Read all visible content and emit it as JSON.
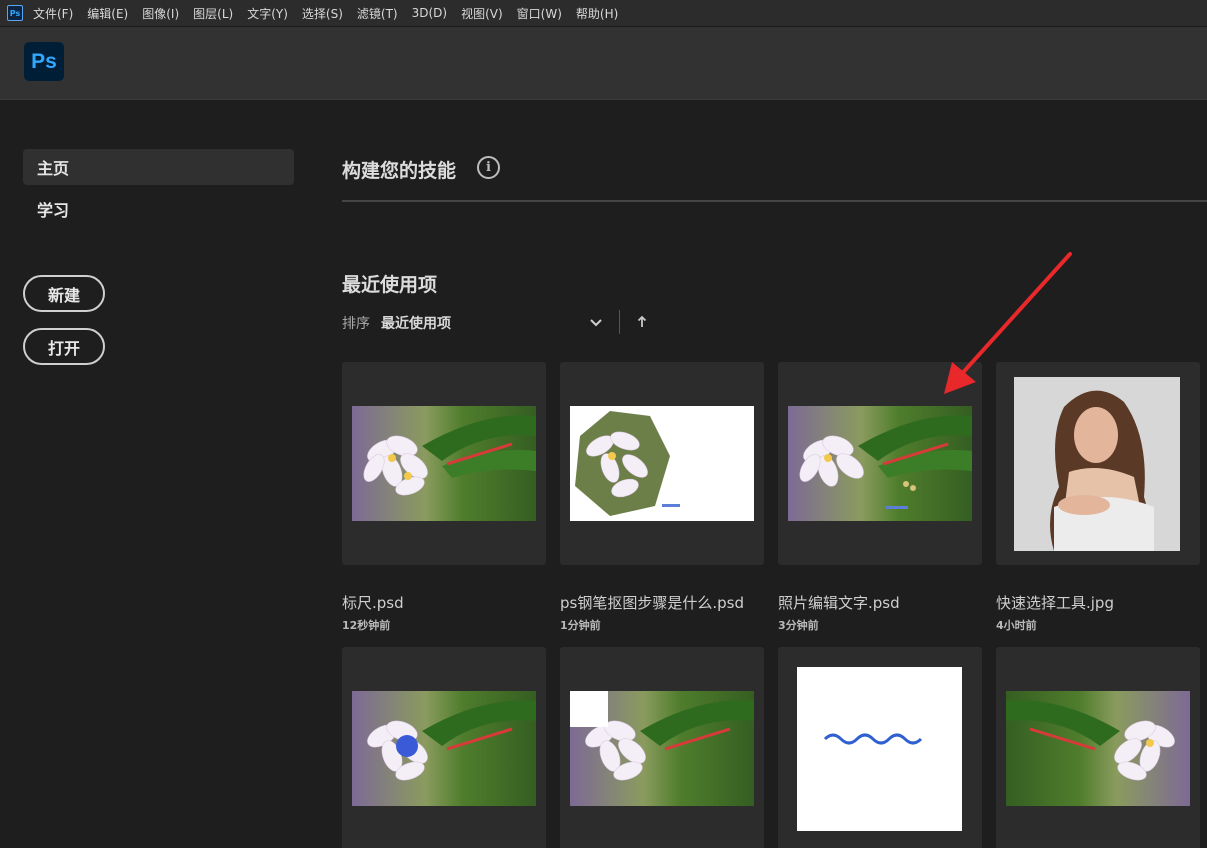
{
  "menubar": {
    "app_icon_text": "Ps",
    "items": [
      "文件(F)",
      "编辑(E)",
      "图像(I)",
      "图层(L)",
      "文字(Y)",
      "选择(S)",
      "滤镜(T)",
      "3D(D)",
      "视图(V)",
      "窗口(W)",
      "帮助(H)"
    ]
  },
  "header": {
    "logo_text": "Ps"
  },
  "sidebar": {
    "nav": [
      {
        "label": "主页",
        "active": true
      },
      {
        "label": "学习",
        "active": false
      }
    ],
    "new_label": "新建",
    "open_label": "打开"
  },
  "main": {
    "skills_title": "构建您的技能",
    "info_glyph": "i",
    "recent_title": "最近使用项",
    "sort_label": "排序",
    "sort_value": "最近使用项"
  },
  "recent_files": [
    {
      "name": "标尺.psd",
      "time": "12秒钟前",
      "thumb": "flower"
    },
    {
      "name": "ps钢笔抠图步骤是什么.psd",
      "time": "1分钟前",
      "thumb": "flower-cutout"
    },
    {
      "name": "照片编辑文字.psd",
      "time": "3分钟前",
      "thumb": "flower-text"
    },
    {
      "name": "快速选择工具.jpg",
      "time": "4小时前",
      "thumb": "portrait"
    },
    {
      "name": "",
      "time": "",
      "thumb": "flower-dot"
    },
    {
      "name": "",
      "time": "",
      "thumb": "flower-square"
    },
    {
      "name": "",
      "time": "",
      "thumb": "wave"
    },
    {
      "name": "",
      "time": "",
      "thumb": "flower-flipped"
    }
  ],
  "colors": {
    "background": "#1e1e1e",
    "menubar": "#2c2c2c",
    "header": "#323232",
    "card": "#2c2c2c",
    "ps_blue": "#31a8ff",
    "annotation_red": "#e8282b"
  }
}
